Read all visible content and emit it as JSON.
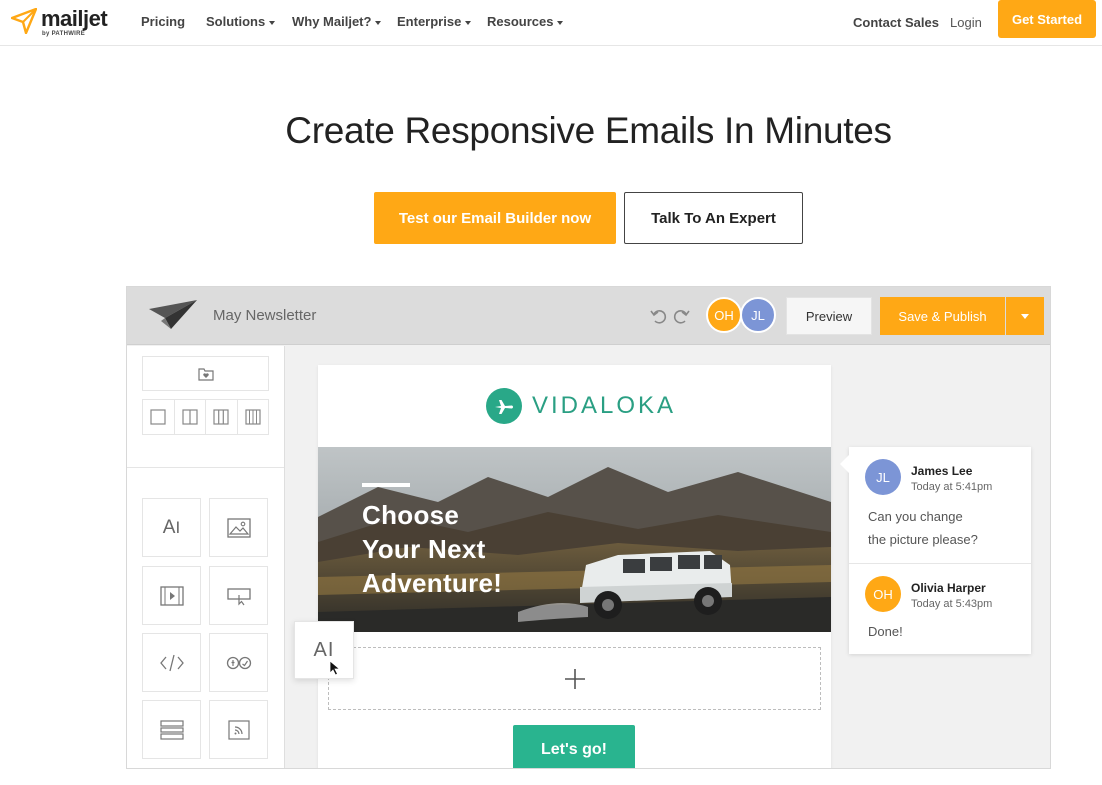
{
  "nav": {
    "logo_text": "mailjet",
    "logo_sub": "by PATHWIRE",
    "items": [
      {
        "label": "Pricing"
      },
      {
        "label": "Solutions"
      },
      {
        "label": "Why Mailjet?"
      },
      {
        "label": "Enterprise"
      },
      {
        "label": "Resources"
      }
    ],
    "contact_sales": "Contact Sales",
    "login": "Login",
    "get_started": "Get Started"
  },
  "hero": {
    "title": "Create Responsive Emails In Minutes",
    "primary_cta": "Test our Email Builder now",
    "secondary_cta": "Talk To An Expert"
  },
  "editor": {
    "title": "May Newsletter",
    "avatars": [
      "OH",
      "JL"
    ],
    "preview": "Preview",
    "save_publish": "Save & Publish",
    "email": {
      "brand": "VIDALOKA",
      "headline_lines": [
        "Choose",
        "Your Next",
        "Adventure!"
      ],
      "cta": "Let's go!",
      "drag_label": "AI"
    }
  },
  "comments": [
    {
      "initials": "JL",
      "name": "James Lee",
      "time": "Today at 5:41pm",
      "text_lines": [
        "Can you change",
        "the picture please?"
      ]
    },
    {
      "initials": "OH",
      "name": "Olivia Harper",
      "time": "Today at 5:43pm",
      "text_lines": [
        "Done!"
      ]
    }
  ],
  "colors": {
    "accent_orange": "#ffa815",
    "brand_teal": "#29a888",
    "cta_green": "#29b48f",
    "avatar_blue": "#7c95d6"
  }
}
